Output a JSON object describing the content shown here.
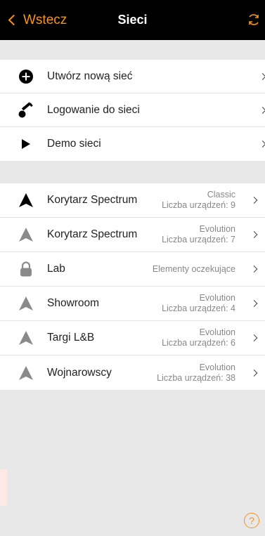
{
  "navbar": {
    "back_label": "Wstecz",
    "title": "Sieci",
    "accent_color": "#f7931e",
    "background": "#000000"
  },
  "actions": [
    {
      "label": "Utwórz nową sieć",
      "icon": "plus-circle-icon"
    },
    {
      "label": "Logowanie do sieci",
      "icon": "key-icon"
    },
    {
      "label": "Demo sieci",
      "icon": "play-icon"
    }
  ],
  "networks": [
    {
      "name": "Korytarz Spectrum",
      "type": "Classic",
      "devices": "Liczba urządzeń: 9",
      "icon": "network-black-icon"
    },
    {
      "name": "Korytarz Spectrum",
      "type": "Evolution",
      "devices": "Liczba urządzeń: 7",
      "icon": "network-gray-icon"
    },
    {
      "name": "Lab",
      "type": "Elementy oczekujące",
      "devices": "",
      "icon": "lock-icon"
    },
    {
      "name": "Showroom",
      "type": "Evolution",
      "devices": "Liczba urządzeń: 4",
      "icon": "network-gray-icon"
    },
    {
      "name": "Targi L&B",
      "type": "Evolution",
      "devices": "Liczba urządzeń: 6",
      "icon": "network-gray-icon"
    },
    {
      "name": "Wojnarowscy",
      "type": "Evolution",
      "devices": "Liczba urządzeń: 38",
      "icon": "network-gray-icon"
    }
  ],
  "help": {
    "label": "?"
  }
}
